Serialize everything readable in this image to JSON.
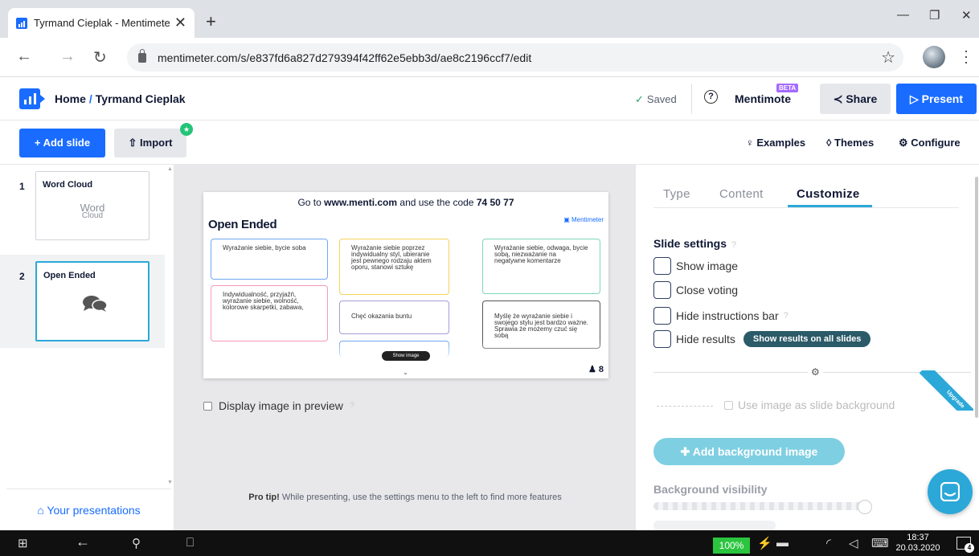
{
  "browser": {
    "tab_title": "Tyrmand Cieplak - Mentimeter",
    "url": "mentimeter.com/s/e837fd6a827d279394f42ff62e5ebb3d/ae8c2196ccf7/edit"
  },
  "header": {
    "home": "Home",
    "separator": "/",
    "presentation": "Tyrmand Cieplak",
    "saved": "Saved",
    "mentimote": "Mentimote",
    "beta": "BETA",
    "share": "Share",
    "present": "Present"
  },
  "toolbar": {
    "add_slide": "+ Add slide",
    "import": "Import",
    "examples": "Examples",
    "themes": "Themes",
    "configure": "Configure"
  },
  "slides": [
    {
      "num": "1",
      "label": "Word Cloud",
      "thumb": [
        "Word",
        "Cloud"
      ]
    },
    {
      "num": "2",
      "label": "Open Ended"
    }
  ],
  "sidebar": {
    "your_presentations": "Your presentations"
  },
  "preview": {
    "instruction_pre": "Go to ",
    "instruction_site": "www.menti.com",
    "instruction_mid": " and use the code ",
    "instruction_code": "74 50 77",
    "title": "Open Ended",
    "brand": "Mentimeter",
    "responses": [
      {
        "text": "Wyrażanie siebie, bycie soba",
        "color": "#6ea8f0"
      },
      {
        "text": "Wyrażanie siebie poprzez indywidualny styl, ubieranie jest pewnego rodzaju aktem oporu, stanowi sztukę",
        "color": "#f2d35b"
      },
      {
        "text": "Wyrażanie siebie, odwaga, bycie sobą, niezważanie na negatywne komentarze",
        "color": "#7fd6b8"
      },
      {
        "text": "Indywidualność, przyjaźń, wyrażanie siebie, wolność, kolorowe skarpetki, zabawa,",
        "color": "#f39bb4"
      },
      {
        "text": "Chęć okazania buntu",
        "color": "#a89bd6"
      },
      {
        "text": "Myślę że wyrażanie siebie i swojego stylu jest bardzo ważne. Sprawia że możemy czuć się sobą",
        "color": "#555555"
      }
    ],
    "show_image": "Show image",
    "votes": "8",
    "display_image": "Display image in preview",
    "protip_bold": "Pro tip!",
    "protip": " While presenting, use the settings menu to the left to find more features"
  },
  "panel": {
    "tabs": [
      "Type",
      "Content",
      "Customize"
    ],
    "slide_settings": "Slide settings",
    "options": [
      "Show image",
      "Close voting",
      "Hide instructions bar",
      "Hide results"
    ],
    "show_results_all": "Show results on all slides",
    "upgrade": "Upgrade",
    "use_image_bg": "Use image as slide background",
    "add_bg_image": "Add background image",
    "bg_visibility": "Background visibility",
    "help": "?"
  },
  "taskbar": {
    "battery": "100%",
    "time": "18:37",
    "date": "20.03.2020",
    "notifications": "4"
  }
}
